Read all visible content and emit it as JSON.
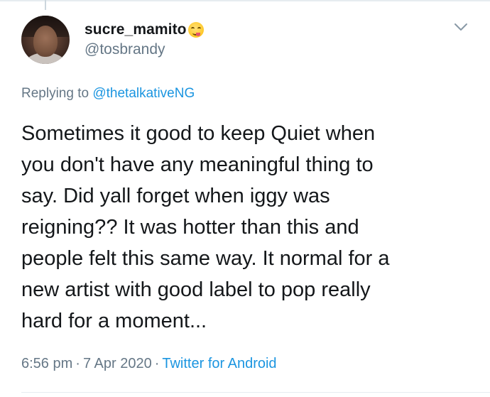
{
  "tweet": {
    "author": {
      "display_name": "sucre_mamito",
      "display_emoji": "face-savoring-food-emoji",
      "handle": "@tosbrandy",
      "avatar": "profile-photo"
    },
    "replying_prefix": "Replying to ",
    "replying_to": "@thetalkativeNG",
    "lines": [
      "Sometimes it good to keep Quiet when",
      "you don't have any meaningful thing to",
      "say. Did yall forget when iggy was",
      "reigning?? It was hotter than this and",
      "people felt this same way. It normal for a",
      "new artist with good label to pop really",
      "hard for a moment..."
    ],
    "time": "6:56 pm",
    "date": "7 Apr 2020",
    "separator": "·",
    "source": "Twitter for Android",
    "menu_icon": "chevron-down-icon"
  },
  "colors": {
    "text": "#14171a",
    "secondary": "#657786",
    "link": "#1b95e0",
    "divider": "#e6ecf0"
  }
}
